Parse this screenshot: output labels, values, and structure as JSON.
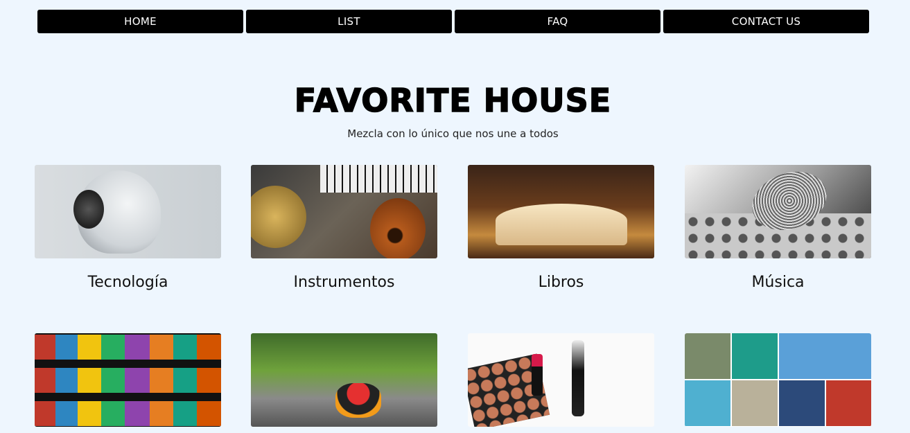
{
  "nav": {
    "items": [
      {
        "label": "HOME"
      },
      {
        "label": "LIST"
      },
      {
        "label": "FAQ"
      },
      {
        "label": "CONTACT US"
      }
    ]
  },
  "header": {
    "title": "FAVORITE HOUSE",
    "subtitle": "Mezcla con lo único que nos une a todos"
  },
  "categories": [
    {
      "label": "Tecnología"
    },
    {
      "label": "Instrumentos"
    },
    {
      "label": "Libros"
    },
    {
      "label": "Música"
    },
    {
      "label": ""
    },
    {
      "label": ""
    },
    {
      "label": ""
    },
    {
      "label": ""
    }
  ],
  "colors": {
    "background": "#eef6fe",
    "nav_bg": "#000000",
    "nav_text": "#ffffff"
  }
}
